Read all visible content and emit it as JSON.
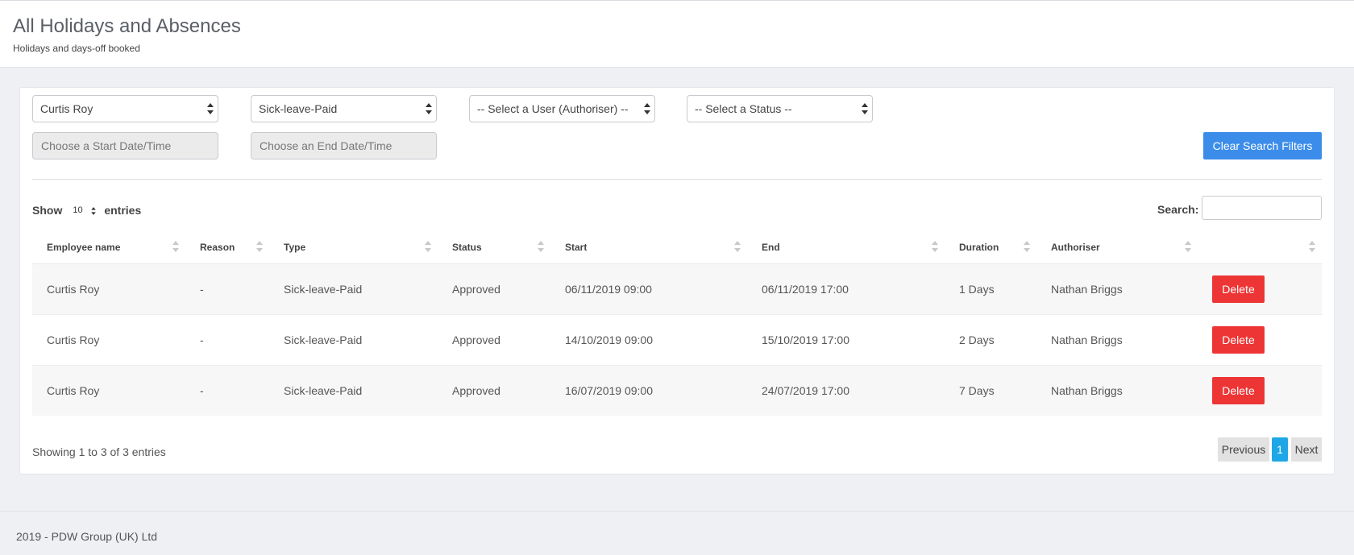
{
  "header": {
    "title": "All Holidays and Absences",
    "subtitle": "Holidays and days-off booked"
  },
  "filters": {
    "employee": "Curtis Roy",
    "type": "Sick-leave-Paid",
    "authoriser": "-- Select a User (Authoriser) --",
    "status": "-- Select a Status --",
    "start_placeholder": "Choose a Start Date/Time",
    "end_placeholder": "Choose an End Date/Time",
    "clear_label": "Clear Search Filters"
  },
  "table_controls": {
    "show_label": "Show",
    "page_length": "10",
    "entries_label": "entries",
    "search_label": "Search:"
  },
  "table": {
    "columns": [
      "Employee name",
      "Reason",
      "Type",
      "Status",
      "Start",
      "End",
      "Duration",
      "Authoriser",
      ""
    ],
    "rows": [
      {
        "employee": "Curtis Roy",
        "reason": "-",
        "type": "Sick-leave-Paid",
        "status": "Approved",
        "start": "06/11/2019 09:00",
        "end": "06/11/2019 17:00",
        "duration": "1 Days",
        "authoriser": "Nathan Briggs",
        "action": "Delete"
      },
      {
        "employee": "Curtis Roy",
        "reason": "-",
        "type": "Sick-leave-Paid",
        "status": "Approved",
        "start": "14/10/2019 09:00",
        "end": "15/10/2019 17:00",
        "duration": "2 Days",
        "authoriser": "Nathan Briggs",
        "action": "Delete"
      },
      {
        "employee": "Curtis Roy",
        "reason": "-",
        "type": "Sick-leave-Paid",
        "status": "Approved",
        "start": "16/07/2019 09:00",
        "end": "24/07/2019 17:00",
        "duration": "7 Days",
        "authoriser": "Nathan Briggs",
        "action": "Delete"
      }
    ]
  },
  "pagination": {
    "info": "Showing 1 to 3 of 3 entries",
    "previous": "Previous",
    "current": "1",
    "next": "Next"
  },
  "footer": {
    "text": "2019 - PDW Group (UK) Ltd"
  },
  "colors": {
    "primary": "#3c8dea",
    "danger": "#ee3535",
    "page_active": "#1ea7e6"
  }
}
